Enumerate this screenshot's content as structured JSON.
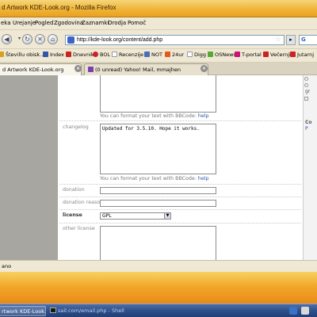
{
  "window": {
    "title": "d Artwork KDE-Look.org - Mozilla Firefox"
  },
  "menu": [
    "eka",
    "Urejanje",
    "Pogled",
    "Zgodovina",
    "Zaznamki",
    "Orodja",
    "Pomoč"
  ],
  "nav": {
    "url": "http://kde-look.org/content/add.php",
    "go_label": "▸",
    "search_engine_label": "G"
  },
  "bookmarks": [
    {
      "label": "Števillu obisk...",
      "icon_color": "#d9a020"
    },
    {
      "label": "Index",
      "icon_color": "#3355aa"
    },
    {
      "label": "Dnevnik",
      "icon_color": "#cc2222"
    },
    {
      "label": "BOL",
      "icon_color": "#cc2222"
    },
    {
      "label": "Recenzije",
      "icon_color": "#ffffff"
    },
    {
      "label": "NOT",
      "icon_color": "#4a6fb8"
    },
    {
      "label": "24ur",
      "icon_color": "#e35a1a"
    },
    {
      "label": "Digg",
      "icon_color": "#ffffff"
    },
    {
      "label": "OSNews",
      "icon_color": "#55aa33"
    },
    {
      "label": "T-portal",
      "icon_color": "#cc1177"
    },
    {
      "label": "Večernji",
      "icon_color": "#cc2222"
    },
    {
      "label": "Jutarnj",
      "icon_color": "#cc2222"
    }
  ],
  "tabs": [
    {
      "label": "d Artwork KDE-Look.org",
      "close": "×"
    },
    {
      "label": "(0 unread) Yahoo! Mail, mmajhen",
      "close": "×"
    }
  ],
  "form": {
    "format_hint": "You can format your text with BBCode:",
    "help_link": "help",
    "changelog_label": "changelog",
    "changelog_value": "Updated for 3.5.10. Hope it works.",
    "donation_label": "donation",
    "donation_reason_label": "donation reason",
    "license_label": "license",
    "license_value": "GPL",
    "other_license_label": "other license"
  },
  "right_pane": {
    "r1": "gr",
    "r2": "Co",
    "r3": "P"
  },
  "status": {
    "text": "ano"
  },
  "taskbar": {
    "items": [
      {
        "label": "rtwork KDE-Look.org ..."
      },
      {
        "label": "sail.com/email.php - Shell"
      }
    ]
  }
}
